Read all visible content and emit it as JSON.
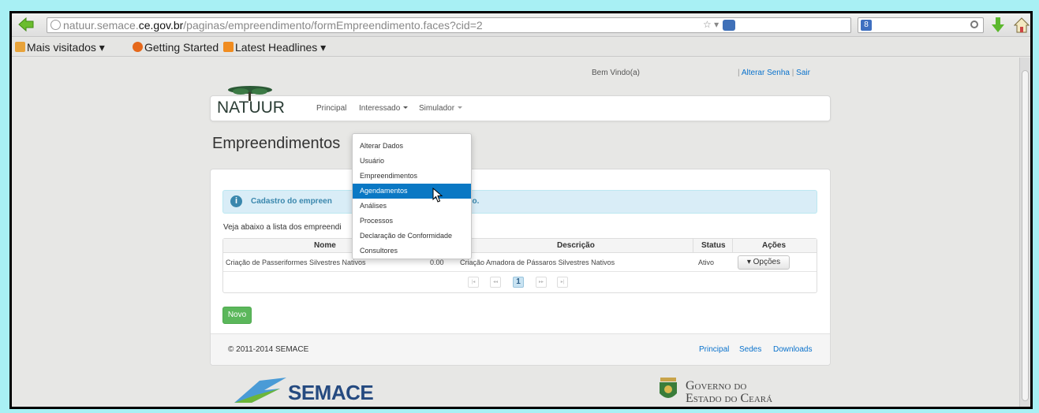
{
  "browser": {
    "url_prefix": "natuur.semace.",
    "url_domain": "ce.gov.br",
    "url_path": "/paginas/empreendimento/formEmpreendimento.faces?cid=2",
    "bookmarks": [
      {
        "label": "Mais visitados ▾",
        "icon": "folder-icon",
        "color": "#e8a33a"
      },
      {
        "label": "Getting Started",
        "icon": "firefox-icon",
        "color": "#e5681b"
      },
      {
        "label": "Latest Headlines ▾",
        "icon": "rss-icon",
        "color": "#f08c20"
      }
    ]
  },
  "header": {
    "welcome": "Bem Vindo(a)",
    "separator": "|",
    "change_password": "Alterar Senha",
    "logout": "Sair"
  },
  "nav": {
    "logo": "NATUUR",
    "items": [
      "Principal",
      "Interessado",
      "Simulador"
    ]
  },
  "dropdown": {
    "items": [
      "Alterar Dados",
      "Usuário",
      "Empreendimentos",
      "Agendamentos",
      "Análises",
      "Processos",
      "Declaração de Conformidade",
      "Consultores"
    ],
    "active": "Agendamentos"
  },
  "page": {
    "title": "Empreendimentos",
    "alert_start": "Cadastro do empreen",
    "alert_end": "so.",
    "intro": "Veja abaixo a lista dos empreendi"
  },
  "table": {
    "headers": [
      "Nome",
      "Descrição",
      "Status",
      "Ações"
    ],
    "rows": [
      {
        "nome": "Criação de Passeriformes Silvestres Nativos",
        "valor": "0.00",
        "descricao": "Criação Amadora de Pássaros Silvestres Nativos",
        "status": "Ativo",
        "acao": "▾ Opções"
      }
    ],
    "pager": {
      "first": "|◂",
      "prev": "◂◂",
      "current": "1",
      "next": "▸▸",
      "last": "▸|"
    }
  },
  "buttons": {
    "novo": "Novo"
  },
  "footer": {
    "copyright": "© 2011-2014 SEMACE",
    "links": [
      "Principal",
      "Sedes",
      "Downloads"
    ]
  },
  "logos": {
    "semace": "SEMACE",
    "gov_line1": "Governo do",
    "gov_line2": "Estado do Ceará"
  },
  "colors": {
    "accent": "#0a78c4",
    "success": "#5bb75b",
    "info": "#3a87ad"
  }
}
